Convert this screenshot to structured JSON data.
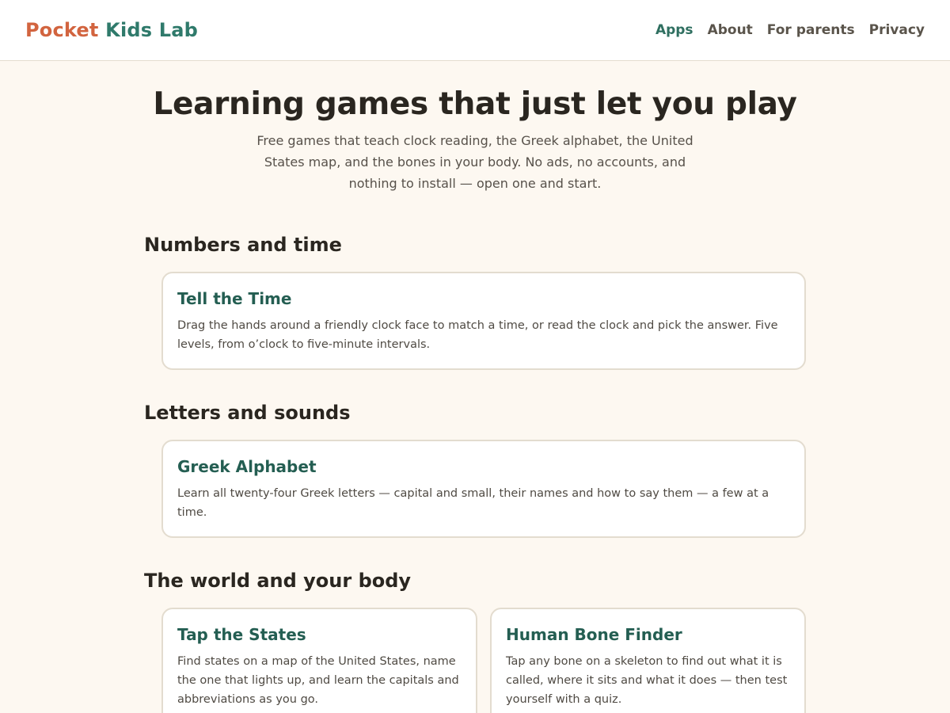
{
  "brand": {
    "part1": "Pocket",
    "part2": "Kids Lab"
  },
  "nav": {
    "items": [
      "Apps",
      "About",
      "For parents",
      "Privacy"
    ],
    "active": "Apps"
  },
  "hero": {
    "title": "Learning games that just let you play",
    "subtitle": "Free games that teach clock reading, the Greek alphabet, the United States map, and the bones in your body. No ads, no accounts, and nothing to install — open one and start."
  },
  "sections": [
    {
      "title": "Numbers and time",
      "cards": [
        {
          "title": "Tell the Time",
          "desc": "Drag the hands around a friendly clock face to match a time, or read the clock and pick the answer. Five levels, from o’clock to five-minute intervals."
        }
      ]
    },
    {
      "title": "Letters and sounds",
      "cards": [
        {
          "title": "Greek Alphabet",
          "desc": "Learn all twenty-four Greek letters — capital and small, their names and how to say them — a few at a time."
        }
      ]
    },
    {
      "title": "The world and your body",
      "cards": [
        {
          "title": "Tap the States",
          "desc": "Find states on a map of the United States, name the one that lights up, and learn the capitals and abbreviations as you go."
        },
        {
          "title": "Human Bone Finder",
          "desc": "Tap any bone on a skeleton to find out what it is called, where it sits and what it does — then test yourself with a quiz."
        }
      ]
    }
  ]
}
